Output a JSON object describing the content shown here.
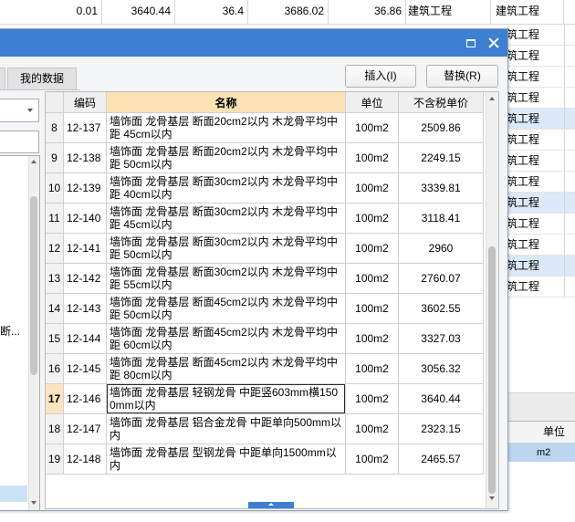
{
  "sheet": {
    "top_row": [
      "0.01",
      "3640.44",
      "36.4",
      "3686.02",
      "36.86",
      "建筑工程",
      "建筑工程"
    ],
    "category_rows": [
      {
        "text": "建筑工程",
        "highlighted": false
      },
      {
        "text": "建筑工程",
        "highlighted": false
      },
      {
        "text": "建筑工程",
        "highlighted": false
      },
      {
        "text": "建筑工程",
        "highlighted": false
      },
      {
        "text": "建筑工程",
        "highlighted": true
      },
      {
        "text": "建筑工程",
        "highlighted": false
      },
      {
        "text": "建筑工程",
        "highlighted": false
      },
      {
        "text": "建筑工程",
        "highlighted": false
      },
      {
        "text": "建筑工程",
        "highlighted": true
      },
      {
        "text": "建筑工程",
        "highlighted": false
      },
      {
        "text": "建筑工程",
        "highlighted": false
      },
      {
        "text": "建筑工程",
        "highlighted": true
      },
      {
        "text": "建筑工程",
        "highlighted": false
      }
    ],
    "lower_grid": {
      "header_unit": "单位",
      "selected_unit": "m2"
    }
  },
  "dialog": {
    "title_icons": [
      "maximize-icon",
      "close-icon"
    ],
    "tabs": {
      "my_data": "我的数据"
    },
    "left_panel": {
      "dropdown_icon": "chevron-down-icon",
      "tree_item": "断..."
    },
    "buttons": {
      "insert": "插入(I)",
      "replace": "替换(R)"
    },
    "table": {
      "headers": {
        "code": "编码",
        "name": "名称",
        "unit": "单位",
        "price": "不含税单价"
      },
      "rows": [
        {
          "index": "8",
          "code": "12-137",
          "name": "墙饰面 龙骨基层 断面20cm2以内 木龙骨平均中距 45cm以内",
          "unit": "100m2",
          "price": "2509.86",
          "selected": false
        },
        {
          "index": "9",
          "code": "12-138",
          "name": "墙饰面 龙骨基层 断面20cm2以内 木龙骨平均中距 50cm以内",
          "unit": "100m2",
          "price": "2249.15",
          "selected": false
        },
        {
          "index": "10",
          "code": "12-139",
          "name": "墙饰面 龙骨基层 断面30cm2以内 木龙骨平均中距 40cm以内",
          "unit": "100m2",
          "price": "3339.81",
          "selected": false
        },
        {
          "index": "11",
          "code": "12-140",
          "name": "墙饰面 龙骨基层 断面30cm2以内 木龙骨平均中距 45cm以内",
          "unit": "100m2",
          "price": "3118.41",
          "selected": false
        },
        {
          "index": "12",
          "code": "12-141",
          "name": "墙饰面 龙骨基层 断面30cm2以内 木龙骨平均中距 50cm以内",
          "unit": "100m2",
          "price": "2960",
          "selected": false
        },
        {
          "index": "13",
          "code": "12-142",
          "name": "墙饰面 龙骨基层 断面30cm2以内 木龙骨平均中距 55cm以内",
          "unit": "100m2",
          "price": "2760.07",
          "selected": false
        },
        {
          "index": "14",
          "code": "12-143",
          "name": "墙饰面 龙骨基层 断面45cm2以内 木龙骨平均中距 50cm以内",
          "unit": "100m2",
          "price": "3602.55",
          "selected": false
        },
        {
          "index": "15",
          "code": "12-144",
          "name": "墙饰面 龙骨基层 断面45cm2以内 木龙骨平均中距 60cm以内",
          "unit": "100m2",
          "price": "3327.03",
          "selected": false
        },
        {
          "index": "16",
          "code": "12-145",
          "name": "墙饰面 龙骨基层 断面45cm2以内 木龙骨平均中距 80cm以内",
          "unit": "100m2",
          "price": "3056.32",
          "selected": false
        },
        {
          "index": "17",
          "code": "12-146",
          "name": "墙饰面 龙骨基层 轻钢龙骨 中距竖603mm横1500mm以内",
          "unit": "100m2",
          "price": "3640.44",
          "selected": true
        },
        {
          "index": "18",
          "code": "12-147",
          "name": "墙饰面 龙骨基层 铝合金龙骨 中距单向500mm以内",
          "unit": "100m2",
          "price": "2323.15",
          "selected": false
        },
        {
          "index": "19",
          "code": "12-148",
          "name": "墙饰面 龙骨基层 型钢龙骨 中距单向1500mm以内",
          "unit": "100m2",
          "price": "2465.57",
          "selected": false
        }
      ]
    }
  },
  "colors": {
    "title_bar": "#3d7fd0",
    "name_header": "#fbe2b5",
    "selected_row_marker": "#fde4bf",
    "sheet_row_highlight": "#dce9f8",
    "selected_cell_blue": "#bcd5f1",
    "tree_selection": "#cce2f7",
    "splitter_handle": "#3d7fd0"
  }
}
